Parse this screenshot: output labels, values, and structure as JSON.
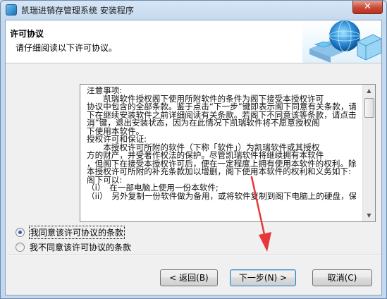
{
  "window": {
    "title": "凯瑞进销存管理系统 安装程序",
    "close_label": "✕"
  },
  "header": {
    "title": "许可协议",
    "subtitle": "请仔细阅读以下许可协议。"
  },
  "license": {
    "lines": [
      "注意事项:",
      "　　凯瑞软件授权阁下使用所附软件的条件为阁下接受本授权许可",
      "协议中包含的全部条款。鉴于点击“下一步”键即表示阁下同意有关条款，请阁",
      "下在继续安装软件之前详细阅读有关条款。若阁下不同意该等条款，请点击“取",
      "消”键，退出安装状态，因为在此情况下凯瑞软件将不愿意授权阁",
      "下使用本软件。",
      "授权许可和保证:",
      "　　本授权许可所附的软件（下称「软件」）为凯瑞软件或其授权",
      "方的财产，并受著作权法的保护。尽管凯瑞软件将继续拥有本软件",
      "，但阁下在接受本授权许可后，便在一定程度上拥有使用本软件的权利。除非经",
      "本授权许可所附的补充条款加以增删，阁下使用本软件的权利和义务如下:",
      "阁下可以:",
      "（i）　在一部电脑上使用一份本软件;",
      "（ii）　另外复制一份软件做为备用，或将软件复制到阁下电脑上的硬盘，保留"
    ]
  },
  "options": {
    "accept_label": "我同意该许可协议的条款",
    "decline_label": "我不同意该许可协议的条款",
    "selected": "accept"
  },
  "buttons": {
    "back_label": "< 返回(B)",
    "next_label": "下一步(N) >",
    "cancel_label": "取消(C)"
  },
  "colors": {
    "arrow": "#e8363b",
    "logo_blue": "#2a8ad6"
  },
  "icons": {
    "app": "installer-icon",
    "header_logo": "globe-cube-logo",
    "scroll_up": "scroll-up-arrow",
    "scroll_down": "scroll-down-arrow"
  }
}
